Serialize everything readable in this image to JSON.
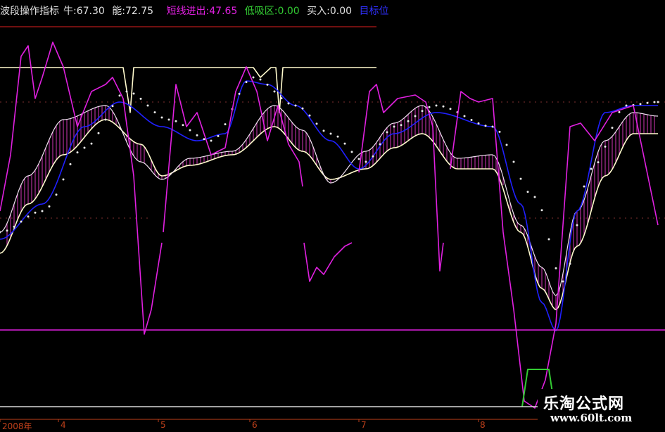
{
  "header": {
    "title": "波段操作指标",
    "niu_label": "牛:",
    "niu_value": "67.30",
    "neng_label": "能:",
    "neng_value": "72.75",
    "short_label": "短线进出:",
    "short_value": "47.65",
    "low_label": "低吸区:",
    "low_value": "0.00",
    "buy_label": "买入:",
    "buy_value": "0.00",
    "extra_label": "目标位"
  },
  "colors": {
    "background": "#000000",
    "magenta": "#e020e0",
    "yellow_white": "#fffacd",
    "blue": "#2020ff",
    "green": "#33cc33",
    "tick_red": "#c0401a"
  },
  "x_axis": {
    "ticks": [
      "2008年",
      "4",
      "5",
      "6",
      "7",
      "8"
    ]
  },
  "watermark": {
    "title": "乐淘公式网",
    "url": "www.60lt.com"
  }
}
